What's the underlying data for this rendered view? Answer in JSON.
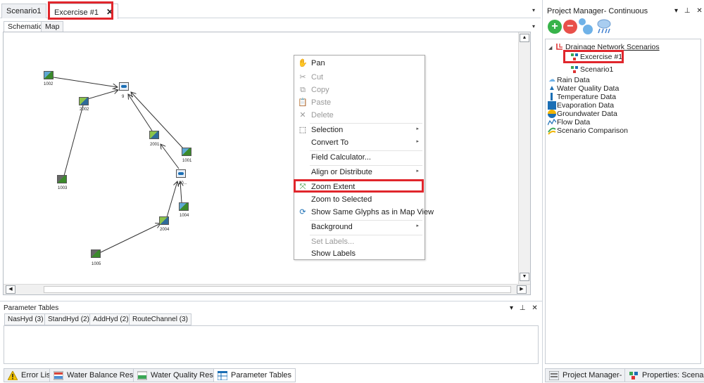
{
  "doc_tabs": [
    {
      "label": "Scenario1"
    },
    {
      "label": "Excercise #1",
      "close": "✕"
    }
  ],
  "inner_tabs": [
    "Schematic",
    "Map"
  ],
  "schematic_nodes": [
    "1002",
    "9",
    "2002",
    "2001",
    "1001",
    "1003",
    "10...",
    "1004",
    "2004",
    "1005"
  ],
  "context_menu": {
    "pan": "Pan",
    "cut": "Cut",
    "copy": "Copy",
    "paste": "Paste",
    "delete": "Delete",
    "selection": "Selection",
    "convert_to": "Convert To",
    "field_calculator": "Field Calculator...",
    "align_distribute": "Align or Distribute",
    "zoom_extent": "Zoom Extent",
    "zoom_selected": "Zoom to Selected",
    "show_glyphs": "Show Same Glyphs as in Map View",
    "background": "Background",
    "set_labels": "Set Labels...",
    "show_labels": "Show Labels"
  },
  "parameter_tables": {
    "title": "Parameter Tables",
    "tabs": [
      "NasHyd (3)",
      "StandHyd (2)",
      "AddHyd (2)",
      "RouteChannel (3)"
    ]
  },
  "bottom_tabs": [
    "Error List",
    "Water Balance Results",
    "Water Quality Results",
    "Parameter Tables"
  ],
  "project_manager": {
    "title": "Project Manager- Continuous",
    "tree": {
      "root": "Drainage Network Scenarios",
      "scenarios": [
        "Excercise #1",
        "Scenario1"
      ],
      "items": [
        "Rain Data",
        "Water Quality Data",
        "Temperature Data",
        "Evaporation Data",
        "Groundwater Data",
        "Flow Data",
        "Scenario Comparison"
      ]
    }
  },
  "right_bottom_tabs": [
    "Project Manager- C...",
    "Properties: Scenar..."
  ],
  "pane_controls": {
    "dropdown": "▾",
    "pin": "⊥",
    "close": "✕"
  },
  "colors": {
    "highlight": "#e0262c",
    "add_green": "#37b34a",
    "remove_red": "#e8504a"
  }
}
